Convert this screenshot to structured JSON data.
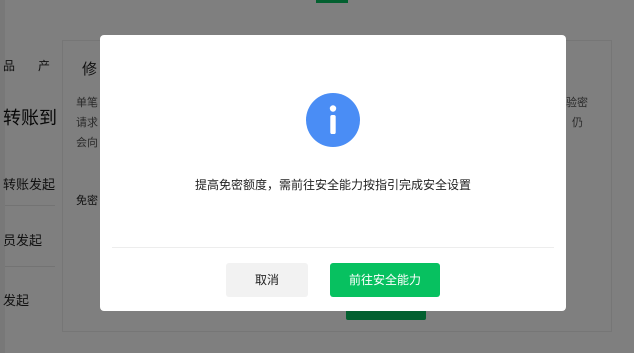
{
  "background": {
    "nav_item_1": "品",
    "nav_item_2": "产",
    "panel_tab": "修",
    "heading_fragment": "转账到",
    "desc_line_1": "单笔",
    "desc_line_2": "请求",
    "desc_line_3": "会向",
    "right_fragment_1": "验密",
    "right_fragment_2": "仍",
    "free_label": "免密",
    "row_1": "转账发起",
    "row_2": "员发起",
    "row_3": "发起"
  },
  "dialog": {
    "icon": "info-icon",
    "message": "提高免密额度，需前往安全能力按指引完成安全设置",
    "cancel_label": "取消",
    "confirm_label": "前往安全能力"
  },
  "colors": {
    "accent": "#07c160",
    "info_icon": "#4a8df5",
    "overlay": "rgba(0,0,0,0.5)"
  }
}
